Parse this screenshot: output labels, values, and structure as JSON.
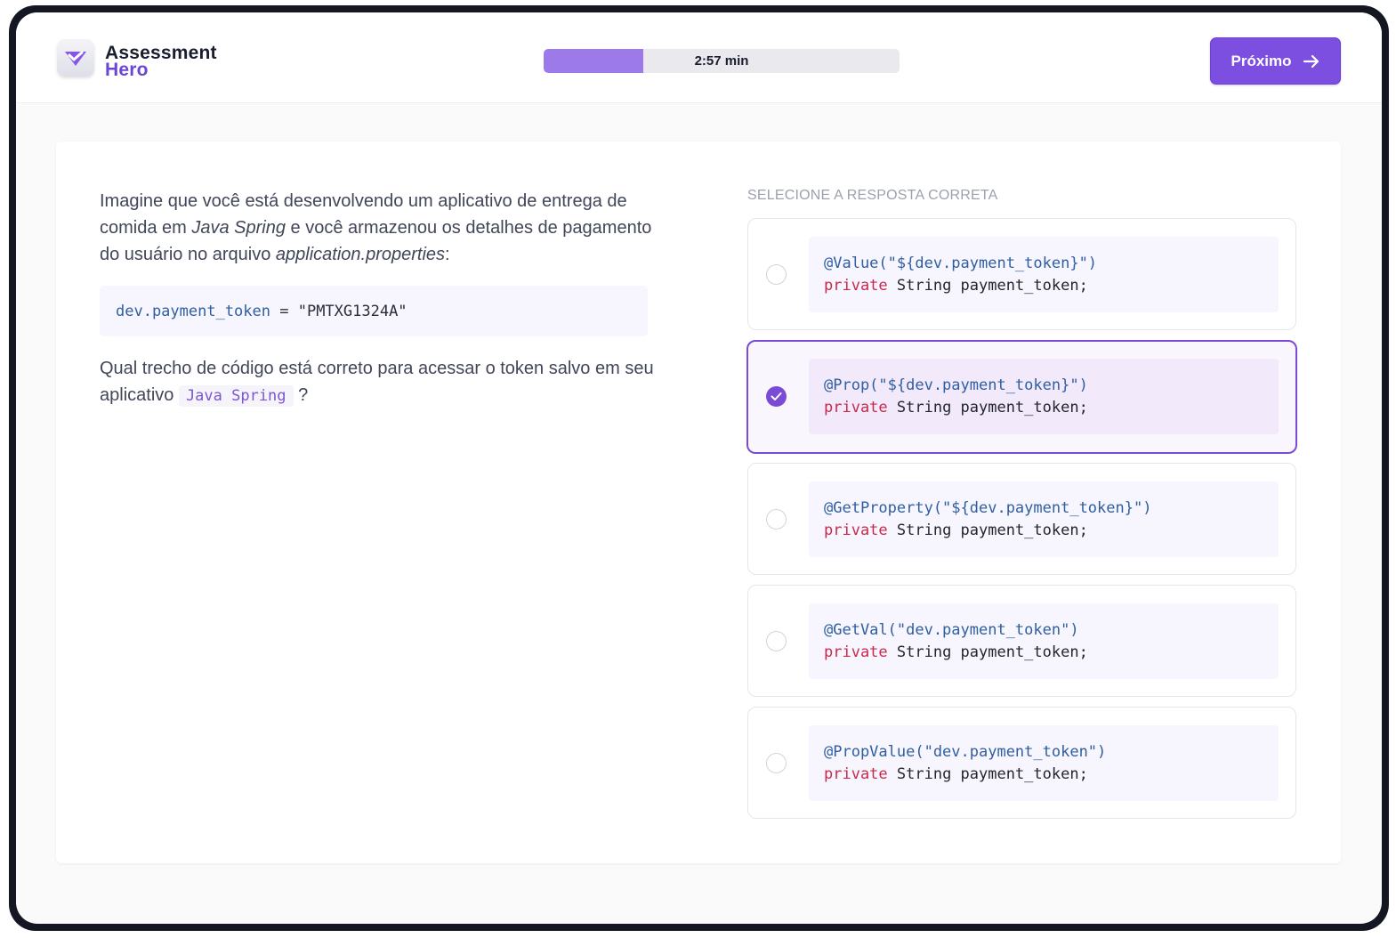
{
  "brand": {
    "line1": "Assessment",
    "line2": "Hero",
    "logo_icon": "check-shield-icon"
  },
  "timer": {
    "text": "2:57 min",
    "progress_fraction": 0.28
  },
  "header": {
    "next_label": "Próximo",
    "next_icon": "arrow-right-icon"
  },
  "question": {
    "p1_a": "Imagine que você está desenvolvendo um aplicativo de entrega de comida em ",
    "p1_em1": "Java Spring",
    "p1_b": " e você armazenou os detalhes de pagamento do usuário no arquivo ",
    "p1_em2": "application.properties",
    "p1_c": ":",
    "code_key": "dev.payment_token",
    "code_eq": " = ",
    "code_value": "\"PMTXG1324A\"",
    "p2_a": "Qual trecho de código está correto para acessar o token salvo em seu aplicativo ",
    "p2_code": "Java Spring",
    "p2_b": " ?"
  },
  "answers": {
    "label": "SELECIONE A RESPOSTA CORRETA",
    "options": [
      {
        "annotation": "@Value(\"${dev.payment_token}\")",
        "kw": "private",
        "rest": " String payment_token;",
        "selected": false
      },
      {
        "annotation": "@Prop(\"${dev.payment_token}\")",
        "kw": "private",
        "rest": " String payment_token;",
        "selected": true
      },
      {
        "annotation": "@GetProperty(\"${dev.payment_token}\")",
        "kw": "private",
        "rest": " String payment_token;",
        "selected": false
      },
      {
        "annotation": "@GetVal(\"dev.payment_token\")",
        "kw": "private",
        "rest": " String payment_token;",
        "selected": false
      },
      {
        "annotation": "@PropValue(\"dev.payment_token\")",
        "kw": "private",
        "rest": " String payment_token;",
        "selected": false
      }
    ]
  },
  "colors": {
    "accent": "#7b4bd6",
    "button": "#7c4fe0",
    "timer_fill": "#9d7ae9",
    "keyword": "#c92a4b",
    "annotation": "#2f5fa0"
  }
}
